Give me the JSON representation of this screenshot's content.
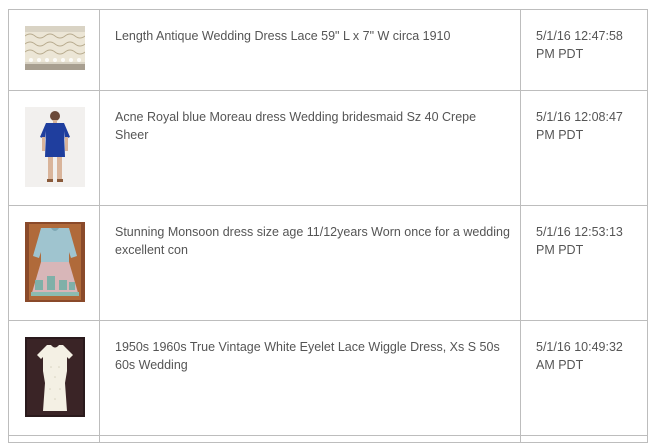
{
  "colors": {
    "text": "#555555",
    "border": "#bdbdbd",
    "background": "#ffffff"
  },
  "listings": [
    {
      "title": "Length Antique Wedding Dress Lace 59\" L x 7\" W circa 1910",
      "date_line1": "5/1/16 12:47:58",
      "date_line2": "PM PDT"
    },
    {
      "title": "Acne Royal blue Moreau dress Wedding bridesmaid Sz 40 Crepe Sheer",
      "date_line1": "5/1/16 12:08:47",
      "date_line2": "PM PDT"
    },
    {
      "title": "Stunning Monsoon dress size age 11/12years Worn once for a wedding excellent con",
      "date_line1": "5/1/16 12:53:13",
      "date_line2": "PM PDT"
    },
    {
      "title": "1950s 1960s True Vintage White Eyelet Lace Wiggle Dress, Xs S 50s 60s Wedding",
      "date_line1": "5/1/16 10:49:32",
      "date_line2": "AM PDT"
    }
  ]
}
